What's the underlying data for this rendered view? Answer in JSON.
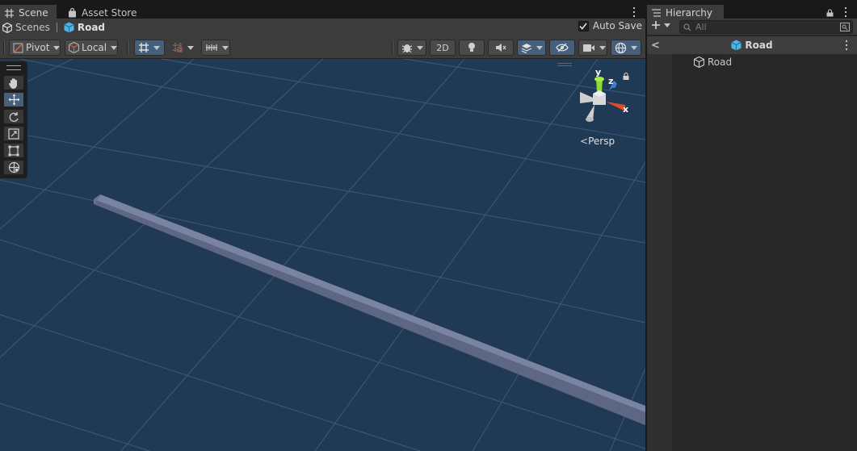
{
  "scene": {
    "tabs": [
      {
        "label": "Scene",
        "icon": "grid-icon"
      },
      {
        "label": "Asset Store",
        "icon": "shopping-bag-icon"
      }
    ],
    "breadcrumb": [
      {
        "label": "Scenes",
        "icon": "unity-logo-icon"
      },
      {
        "label": "Road",
        "icon": "prefab-cube-icon"
      }
    ],
    "auto_save_label": "Auto Save",
    "auto_save_checked": true,
    "toolbar": {
      "pivot_label": "Pivot",
      "local_label": "Local",
      "view_2d_label": "2D"
    },
    "gizmo": {
      "y_label": "y",
      "z_label": "z",
      "x_label": "x"
    },
    "projection_label": "Persp",
    "tools": [
      "hand-icon",
      "move-icon",
      "rotate-icon",
      "scale-icon",
      "rect-icon",
      "transform-icon"
    ],
    "active_tool": "move-icon",
    "colors": {
      "sky": "#203a55",
      "grid": "#3e5a78",
      "road": "#6c7592",
      "accent": "#46607c"
    }
  },
  "hierarchy": {
    "tab_label": "Hierarchy",
    "search_placeholder": "All",
    "header_title": "Road",
    "items": [
      {
        "label": "Road",
        "icon": "cube-icon"
      }
    ]
  }
}
